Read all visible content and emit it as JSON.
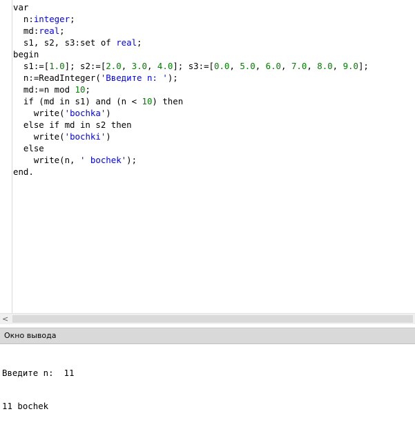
{
  "editor": {
    "lines": [
      [
        {
          "t": "var",
          "c": "kw"
        }
      ],
      [
        {
          "t": "  n:",
          "c": "plain"
        },
        {
          "t": "integer",
          "c": "type"
        },
        {
          "t": ";",
          "c": "plain"
        }
      ],
      [
        {
          "t": "  md:",
          "c": "plain"
        },
        {
          "t": "real",
          "c": "type"
        },
        {
          "t": ";",
          "c": "plain"
        }
      ],
      [
        {
          "t": "  s1, s2, s3:set of ",
          "c": "plain"
        },
        {
          "t": "real",
          "c": "type"
        },
        {
          "t": ";",
          "c": "plain"
        }
      ],
      [
        {
          "t": "begin",
          "c": "kw"
        }
      ],
      [
        {
          "t": "  s1:=[",
          "c": "plain"
        },
        {
          "t": "1.0",
          "c": "num"
        },
        {
          "t": "]; s2:=[",
          "c": "plain"
        },
        {
          "t": "2.0",
          "c": "num"
        },
        {
          "t": ", ",
          "c": "plain"
        },
        {
          "t": "3.0",
          "c": "num"
        },
        {
          "t": ", ",
          "c": "plain"
        },
        {
          "t": "4.0",
          "c": "num"
        },
        {
          "t": "]; s3:=[",
          "c": "plain"
        },
        {
          "t": "0.0",
          "c": "num"
        },
        {
          "t": ", ",
          "c": "plain"
        },
        {
          "t": "5.0",
          "c": "num"
        },
        {
          "t": ", ",
          "c": "plain"
        },
        {
          "t": "6.0",
          "c": "num"
        },
        {
          "t": ", ",
          "c": "plain"
        },
        {
          "t": "7.0",
          "c": "num"
        },
        {
          "t": ", ",
          "c": "plain"
        },
        {
          "t": "8.0",
          "c": "num"
        },
        {
          "t": ", ",
          "c": "plain"
        },
        {
          "t": "9.0",
          "c": "num"
        },
        {
          "t": "];",
          "c": "plain"
        }
      ],
      [
        {
          "t": "  n:=ReadInteger(",
          "c": "plain"
        },
        {
          "t": "'Введите n: '",
          "c": "str"
        },
        {
          "t": ");",
          "c": "plain"
        }
      ],
      [
        {
          "t": "  md:=n mod ",
          "c": "plain"
        },
        {
          "t": "10",
          "c": "num"
        },
        {
          "t": ";",
          "c": "plain"
        }
      ],
      [
        {
          "t": "  if (md in s1) and (n < ",
          "c": "plain"
        },
        {
          "t": "10",
          "c": "num"
        },
        {
          "t": ") then",
          "c": "plain"
        }
      ],
      [
        {
          "t": "    write(",
          "c": "plain"
        },
        {
          "t": "'bochka'",
          "c": "str"
        },
        {
          "t": ")",
          "c": "plain"
        }
      ],
      [
        {
          "t": "  else if md in s2 then",
          "c": "plain"
        }
      ],
      [
        {
          "t": "    write(",
          "c": "plain"
        },
        {
          "t": "'bochki'",
          "c": "str"
        },
        {
          "t": ")",
          "c": "plain"
        }
      ],
      [
        {
          "t": "  else",
          "c": "plain"
        }
      ],
      [
        {
          "t": "    write(n, ",
          "c": "plain"
        },
        {
          "t": "' bochek'",
          "c": "str"
        },
        {
          "t": ");",
          "c": "plain"
        }
      ],
      [
        {
          "t": "end.",
          "c": "kw"
        }
      ]
    ]
  },
  "scrollbar": {
    "left_arrow": "<"
  },
  "output": {
    "title": "Окно вывода",
    "lines": [
      "Введите n:  11",
      "11 bochek"
    ]
  },
  "colors": {
    "keyword": "#000000",
    "type": "#0000ff",
    "number": "#007f00",
    "string": "#0000ff",
    "panel_header": "#d9d9d9"
  }
}
